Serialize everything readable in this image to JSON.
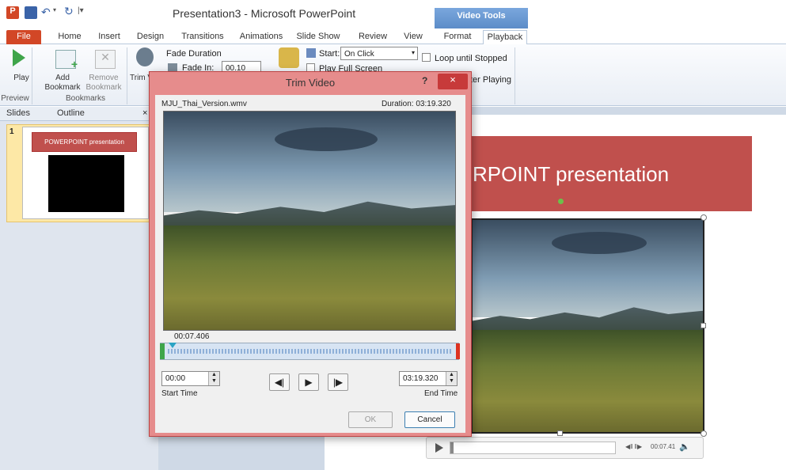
{
  "window": {
    "title": "Presentation3 - Microsoft PowerPoint",
    "context_tab_group": "Video Tools"
  },
  "tabs": [
    "File",
    "Home",
    "Insert",
    "Design",
    "Transitions",
    "Animations",
    "Slide Show",
    "Review",
    "View",
    "Format",
    "Playback"
  ],
  "ribbon": {
    "play_label": "Play",
    "add_bookmark": "Add Bookmark",
    "remove_bookmark": "Remove Bookmark",
    "trim_label": "Trim Video",
    "fade_duration": "Fade Duration",
    "fade_in_label": "Fade In:",
    "fade_in_value": "00.10",
    "start_label": "Start:",
    "start_value": "On Click",
    "play_full_screen": "Play Full Screen",
    "loop_until_stopped": "Loop until Stopped",
    "rewind_after_playing": "ter Playing",
    "group_preview": "Preview",
    "group_bookmarks": "Bookmarks"
  },
  "left_pane": {
    "tab_slides": "Slides",
    "tab_outline": "Outline",
    "slide_number": "1",
    "thumb_title": "POWERPOINT presentation"
  },
  "slide": {
    "title": "RPOINT presentation",
    "player_time": "00:07.41"
  },
  "dialog": {
    "title": "Trim Video",
    "help": "?",
    "close": "×",
    "file_name": "MJU_Thai_Version.wmv",
    "duration": "Duration:  03:19.320",
    "current_time": "00:07.406",
    "start_time_value": "00:00",
    "start_time_label": "Start Time",
    "end_time_value": "03:19.320",
    "end_time_label": "End Time",
    "ok": "OK",
    "cancel": "Cancel"
  }
}
